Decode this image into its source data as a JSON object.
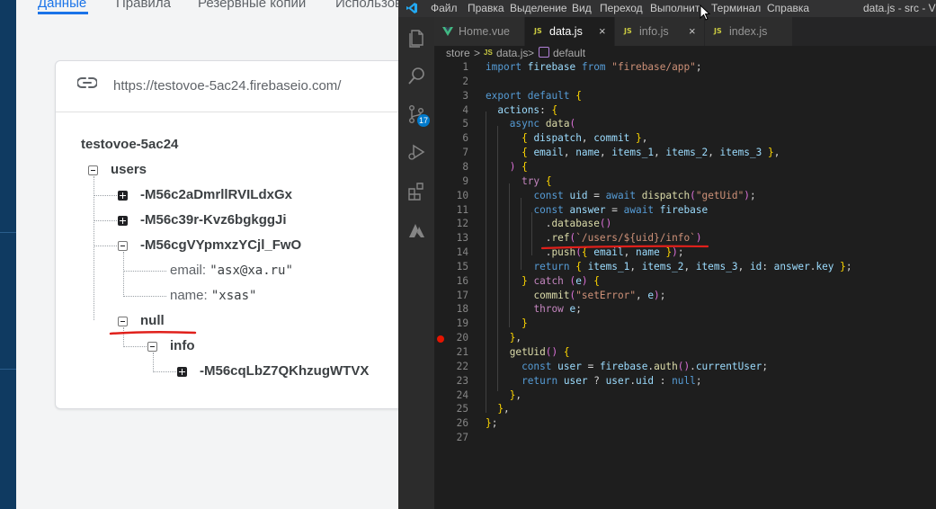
{
  "firebase": {
    "tabs": [
      "Данные",
      "Правила",
      "Резервные копии",
      "Использов"
    ],
    "url": "https://testovoe-5ac24.firebaseio.com/",
    "tree": {
      "root": "testovoe-5ac24",
      "users_key": "users",
      "user1": "-M56c2aDmrllRVILdxGx",
      "user2": "-M56c39r-Kvz6bgkggJi",
      "user3": "-M56cgVYpmxzYCjl_FwO",
      "email_key": "email:",
      "email_value": "\"asx@xa.ru\"",
      "name_key": "name:",
      "name_value": "\"xsas\"",
      "null_key": "null",
      "info_key": "info",
      "info_child": "-M56cqLbZ7QKhzugWTVX"
    },
    "annotation_color": "#e0201b"
  },
  "vscode": {
    "menu": [
      "Файл",
      "Правка",
      "Выделение",
      "Вид",
      "Переход",
      "Выполнить",
      "Терминал",
      "Справка"
    ],
    "window_title": "data.js - src - Visua",
    "scm_badge": "17",
    "tabs": [
      {
        "label": "Home.vue",
        "icon": "vue-icon"
      },
      {
        "label": "data.js",
        "icon": "js-icon",
        "active": true
      },
      {
        "label": "info.js",
        "icon": "js-icon"
      },
      {
        "label": "index.js",
        "icon": "js-icon"
      }
    ],
    "close_glyph": "×",
    "breadcrumb": [
      "store",
      ">",
      "JS",
      "data.js",
      ">",
      "default"
    ],
    "line_numbers": [
      "1",
      "2",
      "3",
      "4",
      "5",
      "6",
      "7",
      "8",
      "9",
      "10",
      "11",
      "12",
      "13",
      "14",
      "15",
      "16",
      "17",
      "18",
      "19",
      "20",
      "21",
      "22",
      "23",
      "24",
      "25",
      "26",
      "27"
    ],
    "breakpoint_line": 20,
    "code": [
      "import firebase from \"firebase/app\";",
      "",
      "export default {",
      "  actions: {",
      "    async data(",
      "      { dispatch, commit },",
      "      { email, name, items_1, items_2, items_3 },",
      "    ) {",
      "      try {",
      "        const uid = await dispatch(\"getUid\");",
      "        const answer = await firebase",
      "          .database()",
      "          .ref(`/users/${uid}/info`)",
      "          .push({ email, name });",
      "        return { items_1, items_2, items_3, id: answer.key };",
      "      } catch (e) {",
      "        commit(\"setError\", e);",
      "        throw e;",
      "      }",
      "    },",
      "    getUid() {",
      "      const user = firebase.auth().currentUser;",
      "      return user ? user.uid : null;",
      "    },",
      "  },",
      "};",
      ""
    ]
  }
}
